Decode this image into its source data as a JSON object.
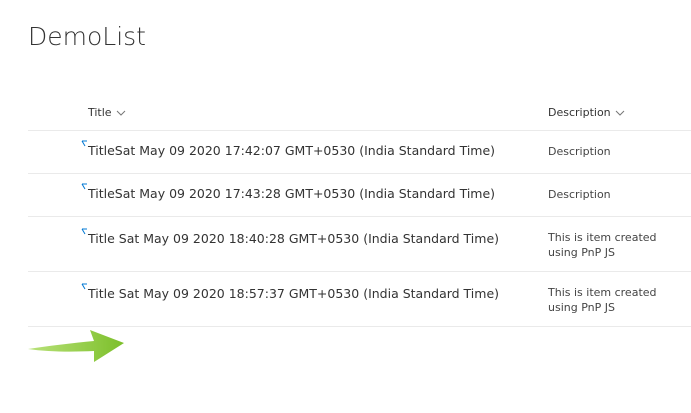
{
  "list": {
    "title": "DemoList"
  },
  "columns": {
    "title": "Title",
    "description": "Description"
  },
  "rows": [
    {
      "title": "TitleSat May 09 2020 17:42:07 GMT+0530 (India Standard Time)",
      "description": "Description"
    },
    {
      "title": "TitleSat May 09 2020 17:43:28 GMT+0530 (India Standard Time)",
      "description": "Description"
    },
    {
      "title": "Title Sat May 09 2020 18:40:28 GMT+0530 (India Standard Time)",
      "description": "This is item created using PnP JS"
    },
    {
      "title": "Title Sat May 09 2020 18:57:37 GMT+0530 (India Standard Time)",
      "description": "This is item created using PnP JS"
    }
  ],
  "icons": {
    "new_item": "new-item-sparkle-icon",
    "sort": "chevron-down-icon",
    "annotation": "green-arrow-icon"
  },
  "colors": {
    "new_item_icon": "#0078d4",
    "arrow": "#8cc63f"
  }
}
